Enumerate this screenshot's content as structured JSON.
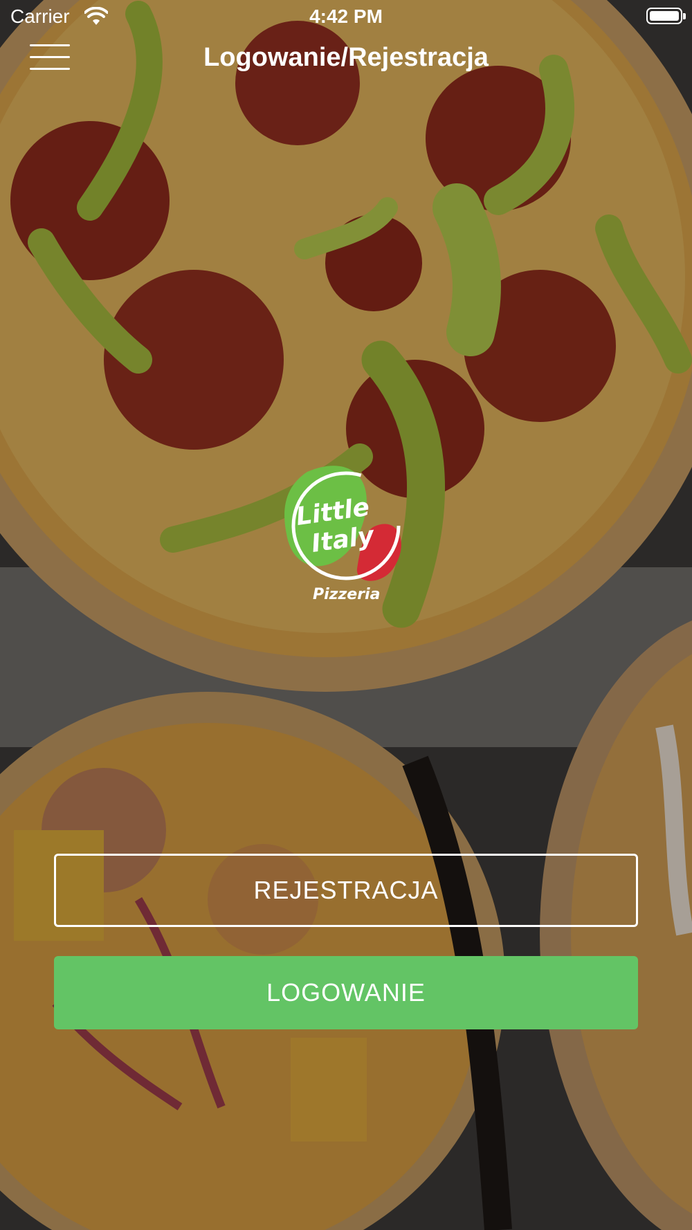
{
  "status_bar": {
    "carrier": "Carrier",
    "time": "4:42 PM",
    "wifi_icon": "wifi-icon",
    "battery_icon": "battery-icon"
  },
  "nav": {
    "title": "Logowanie/Rejestracja",
    "menu_icon": "hamburger-menu-icon"
  },
  "logo": {
    "line1": "Little",
    "line2": "Italy",
    "tagline": "Pizzeria",
    "colors": {
      "green": "#6cbf45",
      "red": "#d42a35",
      "white": "#ffffff"
    }
  },
  "actions": {
    "register_label": "REJESTRACJA",
    "login_label": "LOGOWANIE"
  },
  "colors": {
    "accent_green": "#63c465",
    "text": "#ffffff"
  }
}
